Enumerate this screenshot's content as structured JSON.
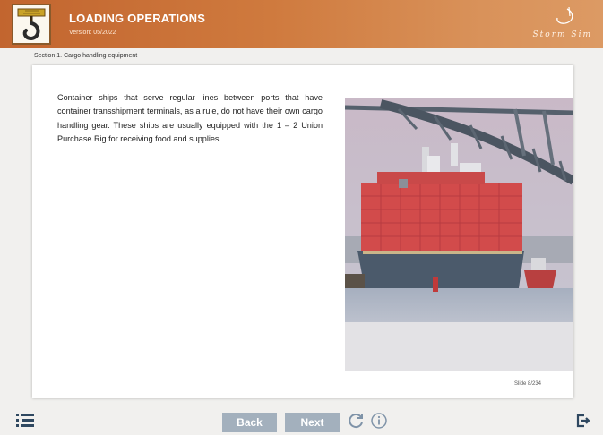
{
  "header": {
    "title": "LOADING OPERATIONS",
    "version": "Version: 05/2022",
    "brand": "Storm Sim"
  },
  "section": {
    "label": "Section 1. Cargo handling equipment"
  },
  "content": {
    "text": "Container ships that serve regular lines between ports that have container transshipment terminals, as a rule, do not have their own cargo handling gear. These ships are usually equipped with the 1 – 2 Union Purchase Rig for receiving food and supplies."
  },
  "slide": {
    "counter": "Slide 8/234"
  },
  "footer": {
    "back_label": "Back",
    "next_label": "Next"
  },
  "icons": {
    "logo": "crane-hook-icon",
    "menu": "list-menu-icon",
    "refresh": "refresh-icon",
    "info": "info-icon",
    "exit": "exit-icon"
  },
  "colors": {
    "header_start": "#c2652f",
    "header_end": "#dc9a64",
    "button": "#a3b0bd",
    "footer_icon": "#2f4860"
  }
}
